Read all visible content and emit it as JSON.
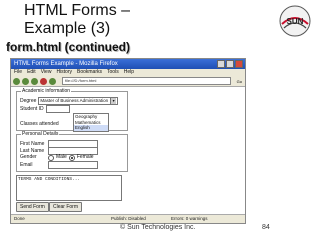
{
  "slide": {
    "title_line1": "HTML Forms –",
    "title_line2": "Example (3)",
    "subtitle": "form.html (continued)",
    "logo_text": "SUN",
    "footer_copyright": "© Sun Technologies Inc.",
    "page_number": "84"
  },
  "browser": {
    "window_title": "HTML Forms Example - Mozilla Firefox",
    "menu": [
      "File",
      "Edit",
      "View",
      "History",
      "Bookmarks",
      "Tools",
      "Help"
    ],
    "address": "file:///D:/form.html",
    "go_label": "Go"
  },
  "form": {
    "academic_legend": "Academic information",
    "degree_label": "Degree",
    "degree_value": "Master of Business Administration",
    "student_id_label": "Student ID",
    "courses_label": "Classes attended",
    "course_options": [
      "Geography",
      "Mathematics",
      "English"
    ],
    "personal_legend": "Personal Details",
    "first_name_label": "First Name",
    "last_name_label": "Last Name",
    "gender_label": "Gender",
    "male_label": "Male",
    "female_label": "Female",
    "email_label": "Email",
    "terms_text": "TERMS AND CONDITIONS...",
    "send_button": "Send Form",
    "clear_button": "Clear Form"
  },
  "status": {
    "left": "Done",
    "middle": "Publish: Disabled",
    "right": "Errors: 0 warnings"
  }
}
